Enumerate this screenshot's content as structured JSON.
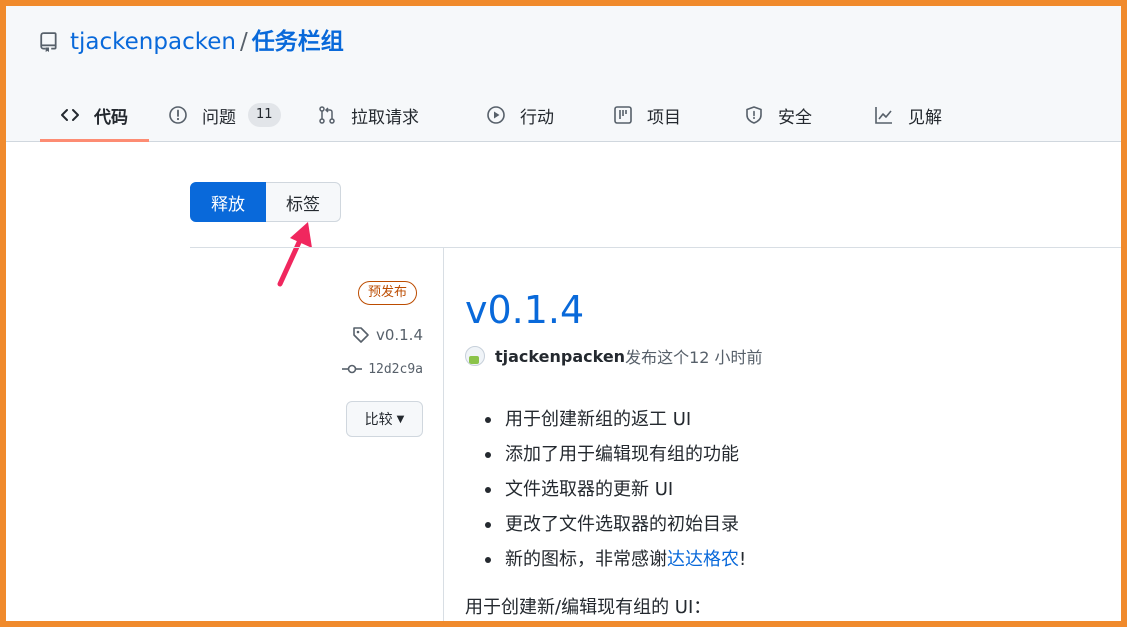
{
  "repo": {
    "owner": "tjackenpacken",
    "separator": "/",
    "name": "任务栏组"
  },
  "tabs": [
    {
      "label": "代码",
      "icon": "code-icon",
      "selected": true
    },
    {
      "label": "问题",
      "icon": "issue-icon",
      "count": "11"
    },
    {
      "label": "拉取请求",
      "icon": "pull-request-icon"
    },
    {
      "label": "行动",
      "icon": "play-icon"
    },
    {
      "label": "项目",
      "icon": "project-icon"
    },
    {
      "label": "安全",
      "icon": "shield-icon"
    },
    {
      "label": "见解",
      "icon": "graph-icon"
    }
  ],
  "subnav": {
    "releases": "释放",
    "tags": "标签"
  },
  "release": {
    "badge": "预发布",
    "tag": "v0.1.4",
    "commit": "12d2c9a",
    "compare_label": "比较",
    "title": "v0.1.4",
    "author": "tjackenpacken",
    "published_text": "发布这个12 小时前",
    "notes": [
      "用于创建新组的返工 UI",
      "添加了用于编辑现有组的功能",
      "文件选取器的更新 UI",
      "更改了文件选取器的初始目录"
    ],
    "last_note_prefix": "新的图标，非常感谢",
    "last_note_link": "达达格农",
    "last_note_suffix": "!",
    "footer": "用于创建新/编辑现有组的 UI："
  },
  "colors": {
    "accent": "#0969da",
    "frame_border": "#f08a2c",
    "prerelease": "#bc4c00",
    "annotation_arrow": "#f0275e",
    "tab_underline": "#fd8c73"
  }
}
